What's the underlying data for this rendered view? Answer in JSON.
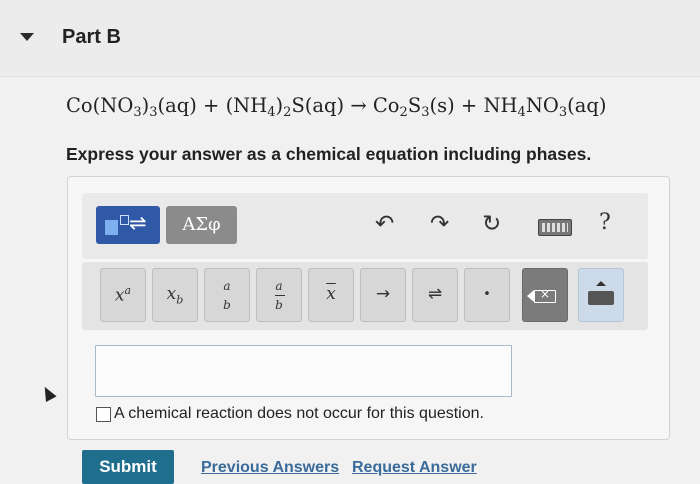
{
  "part": {
    "title": "Part B"
  },
  "question": {
    "equation_parts": {
      "r1": "Co(NO",
      "r1_sub": "3",
      "r1_mid": ")",
      "r1_sub2": "3",
      "r1_phase": "(aq)",
      "plus1": " + ",
      "r2": "(NH",
      "r2_sub": "4",
      "r2_mid": ")",
      "r2_sub2": "2",
      "r2_end": "S(aq)",
      "arrow": " → ",
      "p1": "Co",
      "p1_sub": "2",
      "p1_mid": "S",
      "p1_sub2": "3",
      "p1_phase": "(s)",
      "plus2": " + ",
      "p2": "NH",
      "p2_sub": "4",
      "p2_mid": "NO",
      "p2_sub2": "3",
      "p2_phase": "(aq)"
    },
    "instruction": "Express your answer as a chemical equation including phases."
  },
  "toolbar": {
    "template_arrow": "⇌",
    "greek_label": "ΑΣφ",
    "undo_icon": "↶",
    "redo_icon": "↷",
    "reset_icon": "↻",
    "help_label": "?",
    "keys": {
      "superscript_base": "x",
      "superscript_exp": "a",
      "subscript_base": "x",
      "subscript_sub": "b",
      "frac_num": "a",
      "frac_den": "b",
      "frac2_num": "a",
      "frac2_den": "b",
      "overline": "x",
      "arrow": "→",
      "equilibrium": "⇌",
      "dot": "•"
    }
  },
  "answer": {
    "value": "",
    "no_reaction_label": "A chemical reaction does not occur for this question."
  },
  "actions": {
    "submit": "Submit",
    "previous_answers": "Previous Answers",
    "request_answer": "Request Answer"
  },
  "colors": {
    "submit_bg": "#1f6e8e",
    "template_btn": "#2f58a6",
    "link": "#3a6b9a"
  }
}
